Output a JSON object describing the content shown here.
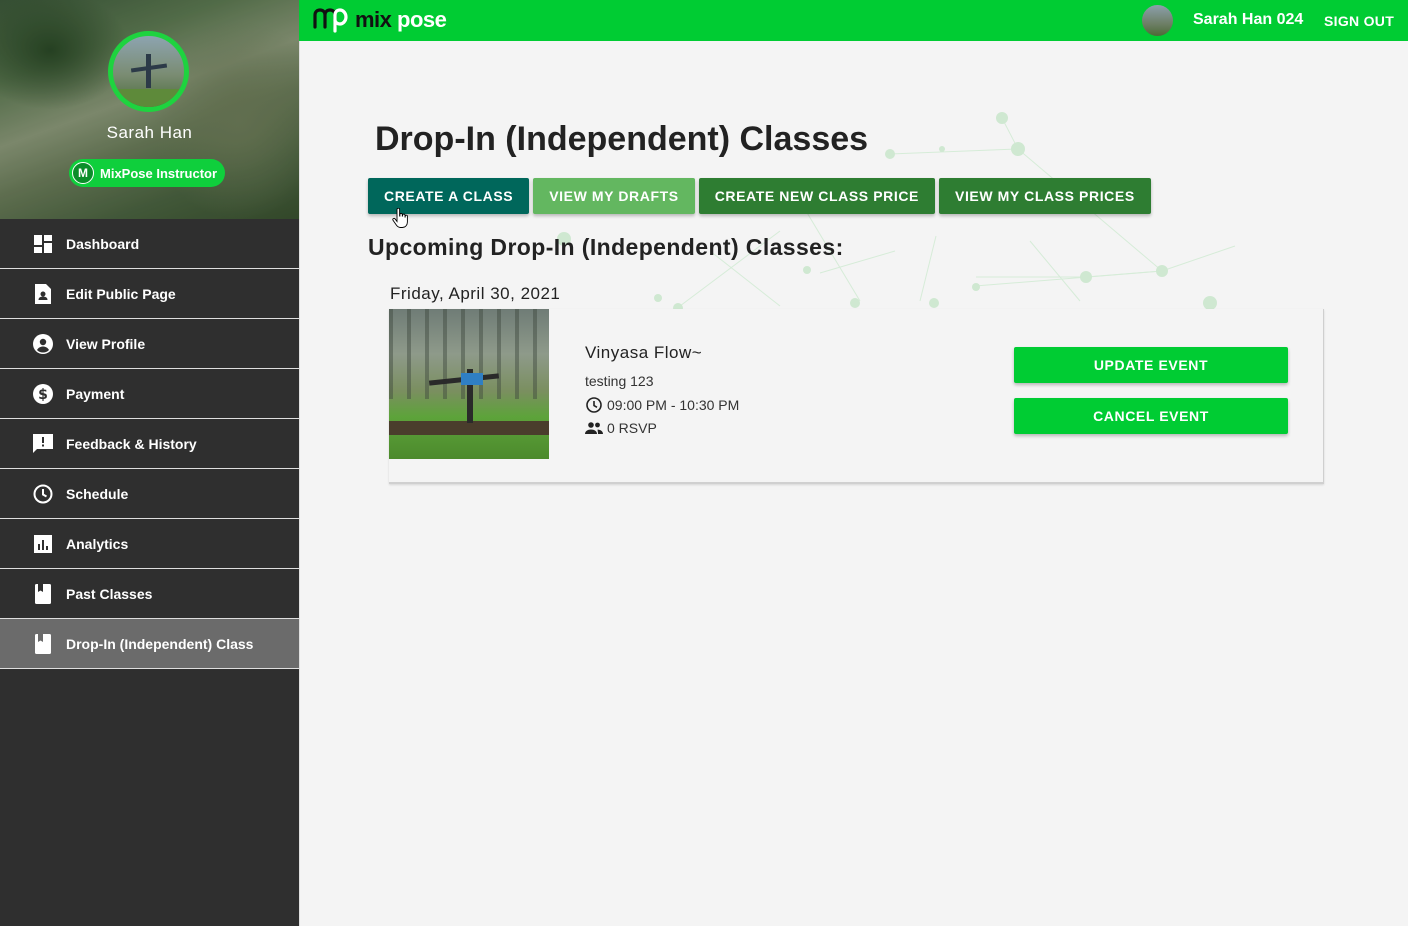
{
  "app": {
    "logo_mark": "mp",
    "logo_text_mix": "mix",
    "logo_text_pose": "pose",
    "brand_color": "#00cc33"
  },
  "header": {
    "user_name": "Sarah Han 024",
    "sign_out_label": "SIGN OUT"
  },
  "sidebar": {
    "profile_name": "Sarah Han",
    "role_initial": "M",
    "role_label": "MixPose Instructor",
    "items": [
      {
        "label": "Dashboard",
        "icon": "dashboard-icon"
      },
      {
        "label": "Edit Public Page",
        "icon": "page-icon"
      },
      {
        "label": "View Profile",
        "icon": "account-icon"
      },
      {
        "label": "Payment",
        "icon": "dollar-icon"
      },
      {
        "label": "Feedback & History",
        "icon": "feedback-icon"
      },
      {
        "label": "Schedule",
        "icon": "clock-icon"
      },
      {
        "label": "Analytics",
        "icon": "analytics-icon"
      },
      {
        "label": "Past Classes",
        "icon": "book-icon"
      },
      {
        "label": "Drop-In (Independent) Class",
        "icon": "book-icon",
        "active": true
      }
    ]
  },
  "main": {
    "title": "Drop-In (Independent) Classes",
    "buttons": {
      "create_class": "CREATE A CLASS",
      "view_drafts": "VIEW MY DRAFTS",
      "create_price": "CREATE NEW CLASS PRICE",
      "view_prices": "VIEW MY CLASS PRICES"
    },
    "section_title": "Upcoming Drop-In (Independent) Classes:",
    "date_label": "Friday, April 30, 2021",
    "event": {
      "name": "Vinyasa Flow~",
      "description": "testing 123",
      "time": "09:00 PM - 10:30 PM",
      "rsvp": "0 RSVP",
      "update_label": "UPDATE EVENT",
      "cancel_label": "CANCEL EVENT"
    }
  }
}
